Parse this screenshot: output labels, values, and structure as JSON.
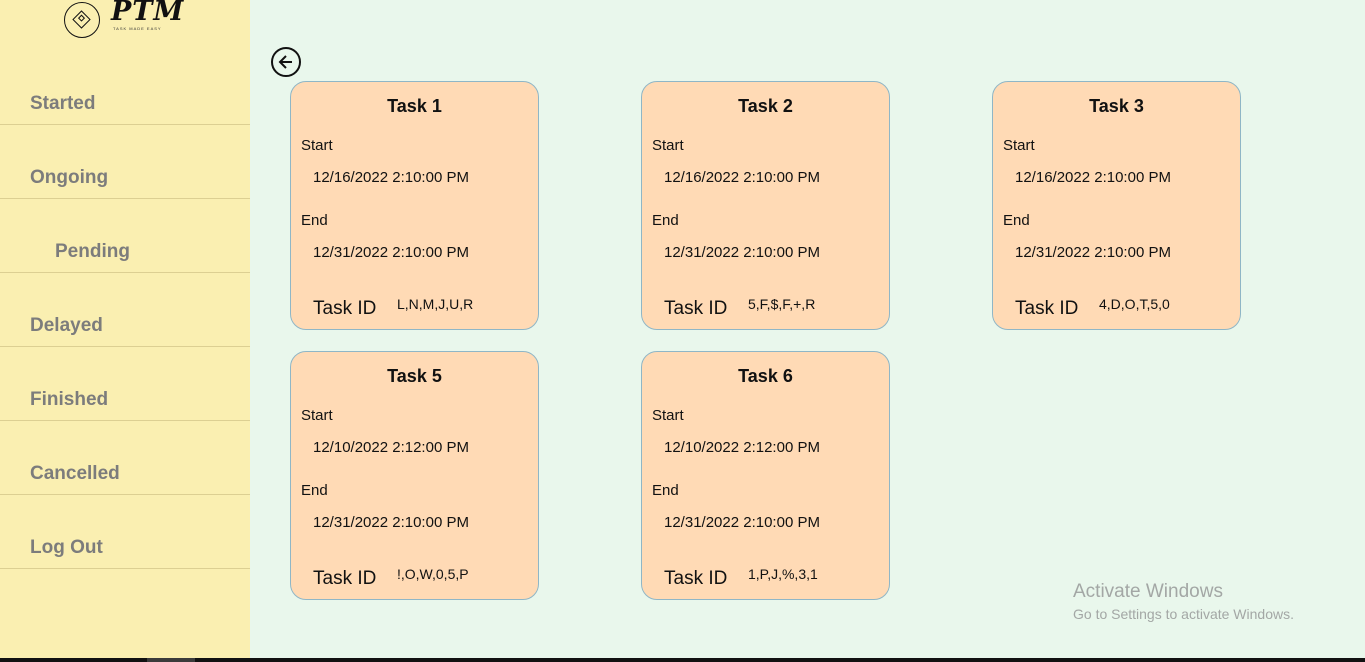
{
  "logo": {
    "text": "PTM",
    "tagline": "TASK MADE EASY"
  },
  "nav": [
    {
      "label": "Started"
    },
    {
      "label": "Ongoing"
    },
    {
      "label": "Pending"
    },
    {
      "label": "Delayed"
    },
    {
      "label": "Finished"
    },
    {
      "label": "Cancelled"
    },
    {
      "label": "Log Out"
    }
  ],
  "labels": {
    "start": "Start",
    "end": "End",
    "task_id": "Task ID"
  },
  "tasks": [
    {
      "title": "Task 1",
      "start": "12/16/2022 2:10:00 PM",
      "end": "12/31/2022 2:10:00 PM",
      "task_id": "L,N,M,J,U,R"
    },
    {
      "title": "Task 2",
      "start": "12/16/2022 2:10:00 PM",
      "end": "12/31/2022 2:10:00 PM",
      "task_id": "5,F,$,F,+,R"
    },
    {
      "title": "Task 3",
      "start": "12/16/2022 2:10:00 PM",
      "end": "12/31/2022 2:10:00 PM",
      "task_id": "4,D,O,T,5,0"
    },
    {
      "title": "Task 5",
      "start": "12/10/2022 2:12:00 PM",
      "end": "12/31/2022 2:10:00 PM",
      "task_id": "!,O,W,0,5,P"
    },
    {
      "title": "Task 6",
      "start": "12/10/2022 2:12:00 PM",
      "end": "12/31/2022 2:10:00 PM",
      "task_id": "1,P,J,%,3,1"
    }
  ],
  "watermark": {
    "line1": "Activate Windows",
    "line2": "Go to Settings to activate Windows."
  },
  "colors": {
    "sidebar": "#faefb1",
    "background": "#e9f7ec",
    "card": "#ffdab5",
    "card_border": "#8fb6c6",
    "nav_text": "#7c7c7c"
  }
}
